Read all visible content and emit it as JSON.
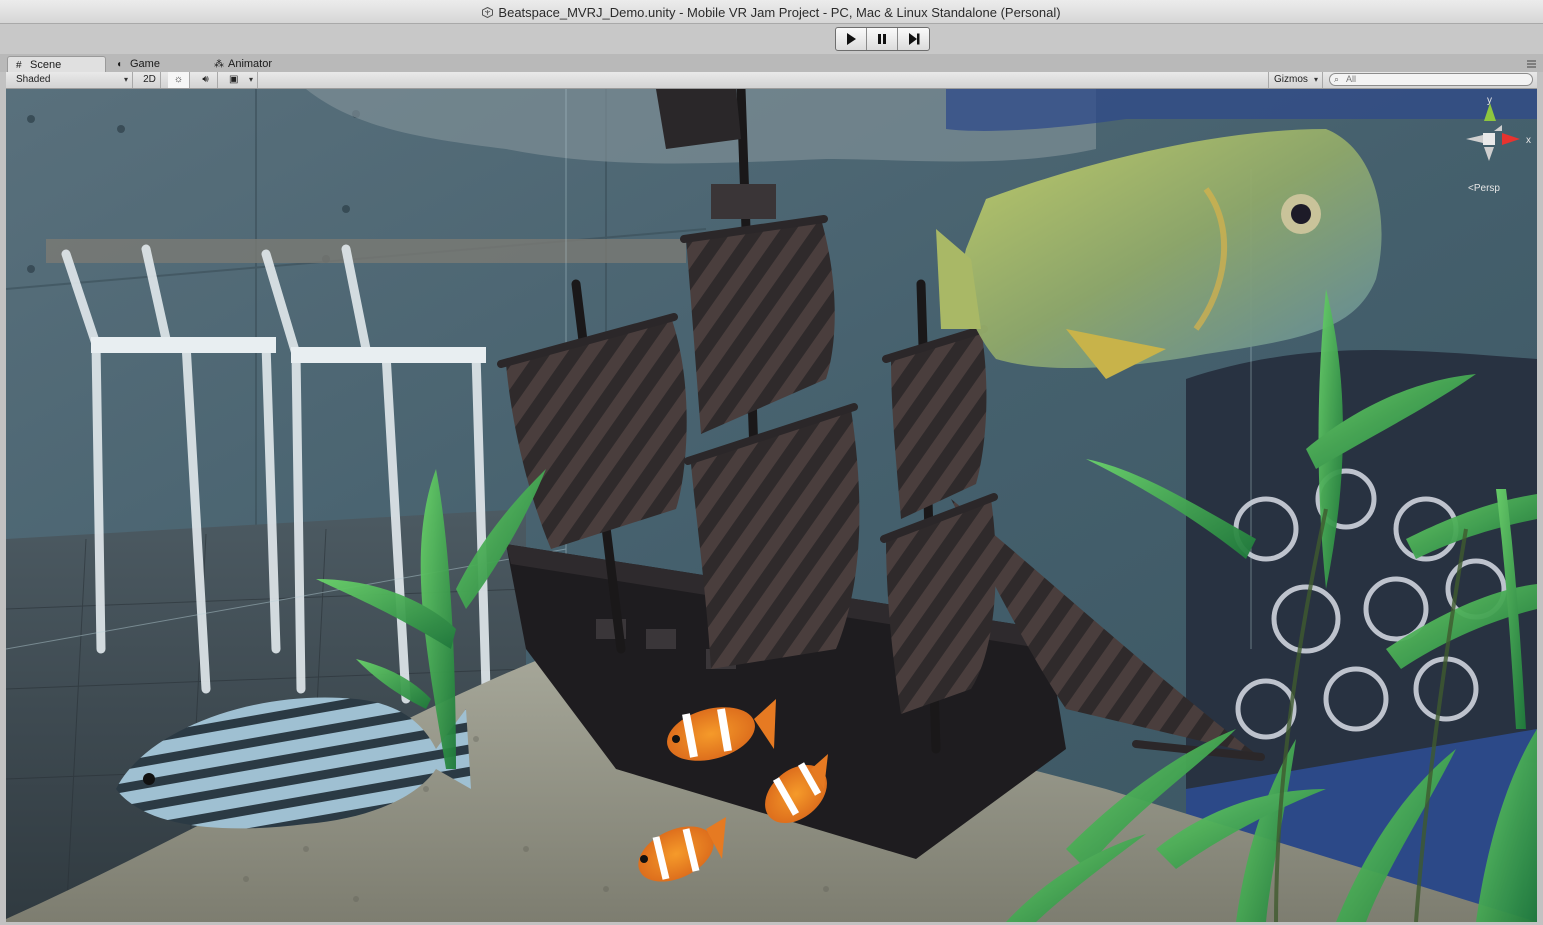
{
  "window": {
    "title": "Beatspace_MVRJ_Demo.unity - Mobile VR Jam Project - PC, Mac & Linux Standalone (Personal)"
  },
  "playbar": {
    "buttons": [
      {
        "name": "play-button",
        "icon": "play-icon"
      },
      {
        "name": "pause-button",
        "icon": "pause-icon"
      },
      {
        "name": "step-button",
        "icon": "step-icon"
      }
    ]
  },
  "tabs": [
    {
      "label": "Scene",
      "icon": "grid-icon",
      "active": true
    },
    {
      "label": "Game",
      "icon": "pacman-icon",
      "active": false
    },
    {
      "label": "Animator",
      "icon": "animator-icon",
      "active": false
    }
  ],
  "toolbar": {
    "draw_mode": "Shaded",
    "mode_2d": "2D",
    "gizmos": "Gizmos",
    "search_placeholder": "All"
  },
  "orientation_gizmo": {
    "y_label": "y",
    "x_label": "x",
    "projection": "Persp"
  },
  "colors": {
    "axis_y": "#8ec63f",
    "axis_x": "#e8332f",
    "accent_title": "#2b2b2b"
  }
}
